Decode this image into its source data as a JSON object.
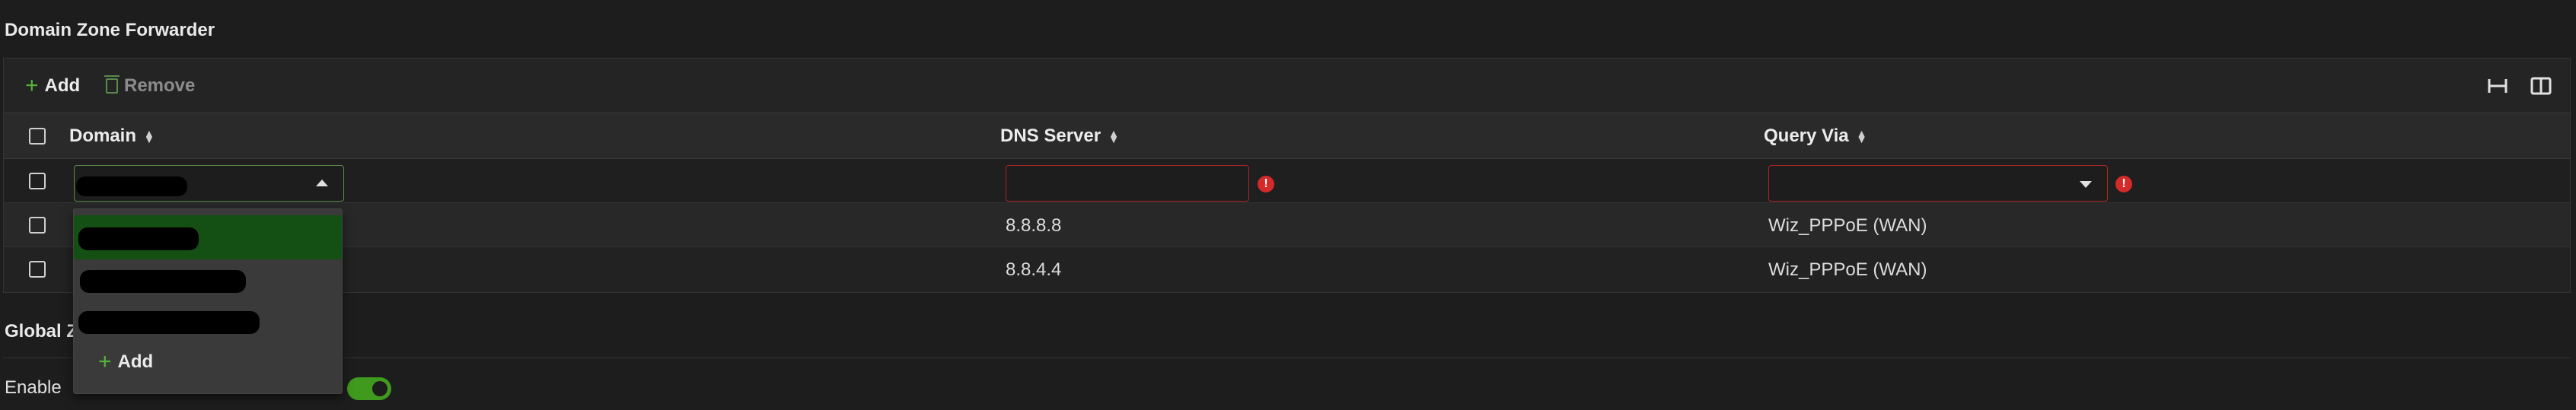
{
  "section_title": "Domain Zone Forwarder",
  "toolbar": {
    "add_label": "Add",
    "remove_label": "Remove"
  },
  "table": {
    "headers": [
      "Domain",
      "DNS Server",
      "Query Via"
    ],
    "rows": [
      {
        "dns_server": "8.8.8.8",
        "query_via": "Wiz_PPPoE (WAN)"
      },
      {
        "dns_server": "8.8.4.4",
        "query_via": "Wiz_PPPoE (WAN)"
      }
    ],
    "edit_row": {
      "error_icon": "!"
    }
  },
  "dropdown": {
    "add_label": "Add"
  },
  "section2_title": "Global Z",
  "enable_label": "Enable",
  "colors": {
    "accent": "#55b43a",
    "error": "#d42a2a",
    "selected": "#145014",
    "toggle": "#3f9a1e"
  }
}
